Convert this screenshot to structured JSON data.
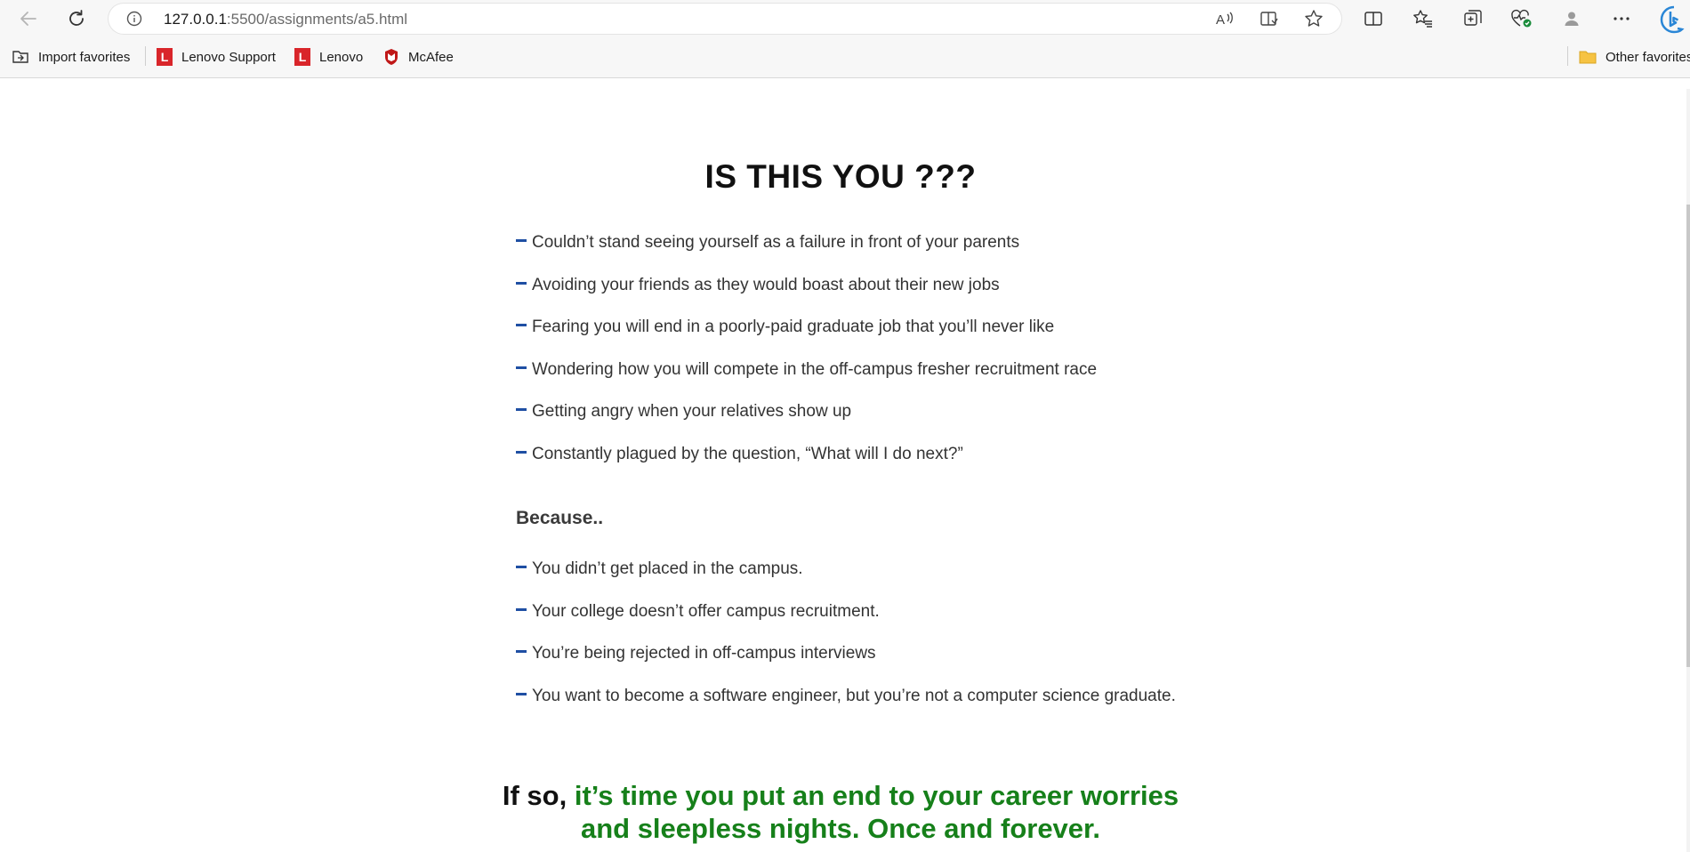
{
  "browser": {
    "url_host": "127.0.0.1",
    "url_path": ":5500/assignments/a5.html",
    "icons": {
      "back": "back-arrow-icon",
      "refresh": "refresh-icon",
      "site_info": "info-icon",
      "read_aloud": "read-aloud-icon",
      "immersive_reader": "immersive-reader-icon",
      "favorite": "star-icon",
      "split_screen": "split-screen-icon",
      "favorites": "favorites-icon",
      "collections": "collections-icon",
      "health": "browser-essentials-icon",
      "profile": "profile-icon",
      "more": "more-icon",
      "bing": "bing-icon"
    }
  },
  "favorites_bar": {
    "items": [
      {
        "label": "Import favorites"
      },
      {
        "label": "Lenovo Support"
      },
      {
        "label": "Lenovo"
      },
      {
        "label": "McAfee"
      }
    ],
    "other": "Other favorites"
  },
  "page": {
    "heading": "IS THIS YOU ???",
    "concerns": [
      "Couldn’t stand seeing yourself as a failure in front of your parents",
      "Avoiding your friends as they would boast about their new jobs",
      "Fearing you will end in a poorly-paid graduate job that you’ll never like",
      "Wondering how you will compete in the off-campus fresher recruitment race",
      "Getting angry when your relatives show up",
      "Constantly plagued by the question, “What will I do next?”"
    ],
    "because_label": "Because..",
    "reasons": [
      "You didn’t get placed in the campus.",
      "Your college doesn’t offer campus recruitment.",
      "You’re being rejected in off-campus interviews",
      "You want to become a software engineer, but you’re not a computer science graduate."
    ],
    "closing_prefix": "If so, ",
    "closing_line1": "it’s time you put an end to your career worries",
    "closing_line2": "and sleepless nights. Once and forever.",
    "colors": {
      "dash": "#1f4fa3",
      "closing_green": "#16801a"
    }
  }
}
